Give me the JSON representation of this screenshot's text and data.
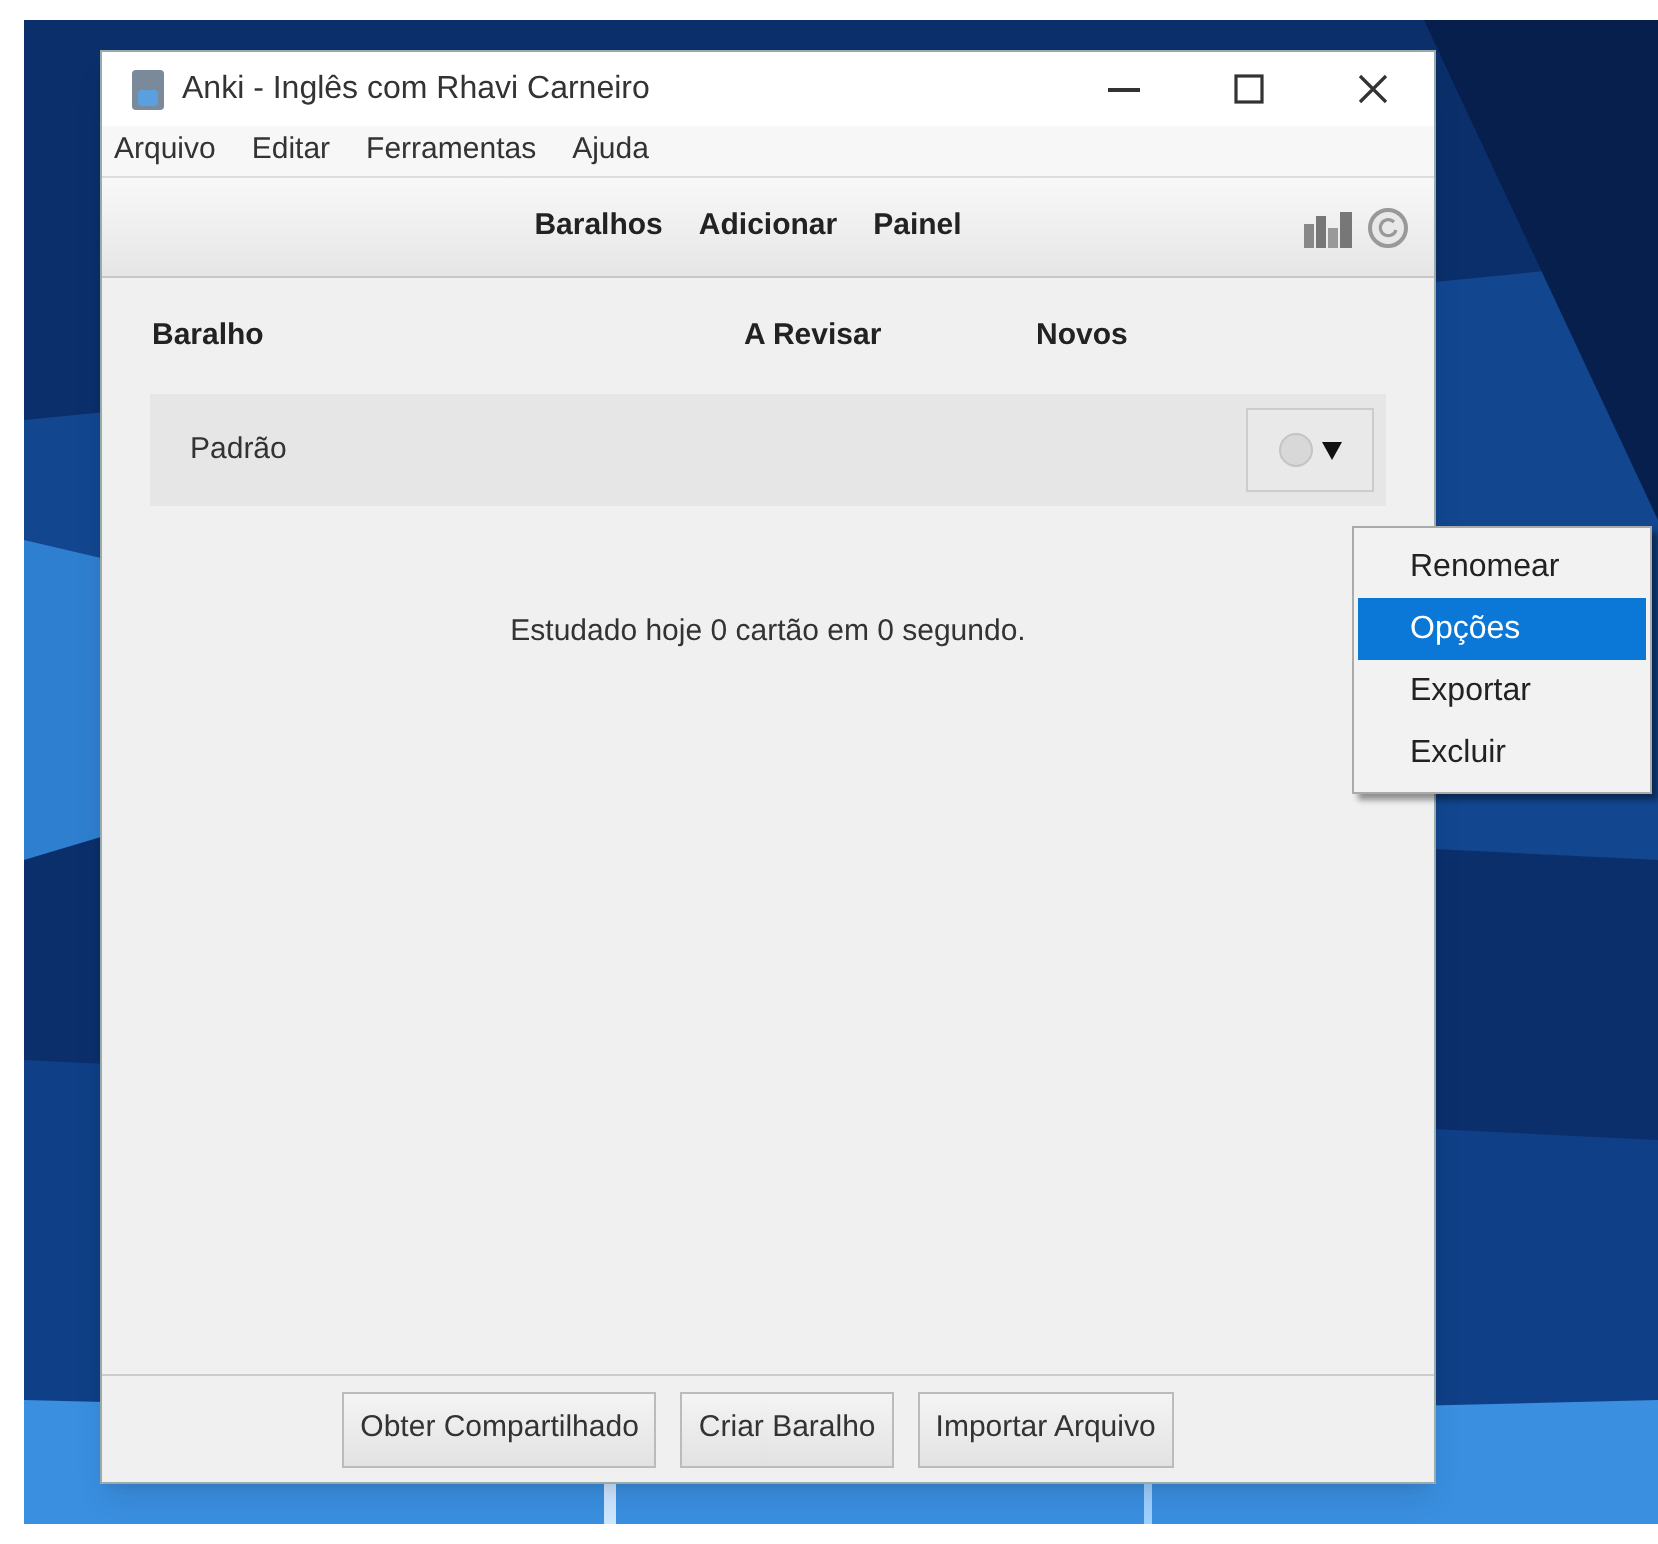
{
  "window": {
    "title": "Anki - Inglês com Rhavi Carneiro"
  },
  "menu_bar": [
    "Arquivo",
    "Editar",
    "Ferramentas",
    "Ajuda"
  ],
  "toolbar": {
    "links": [
      "Baralhos",
      "Adicionar",
      "Painel"
    ]
  },
  "deck_table": {
    "columns": [
      "Baralho",
      "A Revisar",
      "Novos"
    ],
    "rows": [
      {
        "name": "Padrão"
      }
    ]
  },
  "study_summary": "Estudado hoje 0 cartão em 0 segundo.",
  "bottom_buttons": [
    "Obter Compartilhado",
    "Criar Baralho",
    "Importar Arquivo"
  ],
  "context_menu": {
    "items": [
      {
        "label": "Renomear",
        "selected": false
      },
      {
        "label": "Opções",
        "selected": true
      },
      {
        "label": "Exportar",
        "selected": false
      },
      {
        "label": "Excluir",
        "selected": false
      }
    ]
  }
}
